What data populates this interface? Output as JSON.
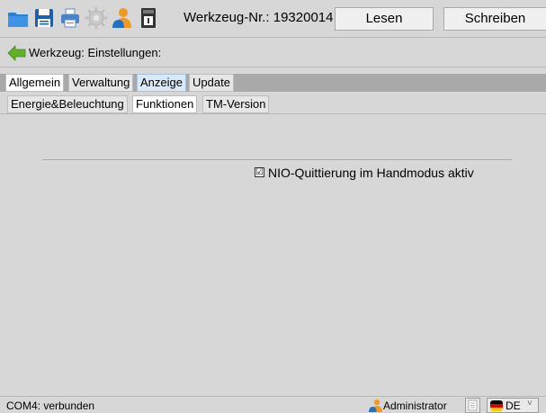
{
  "toolbar": {
    "icons": [
      "folder-icon",
      "save-icon",
      "print-icon",
      "settings-icon",
      "user-icon",
      "device-icon"
    ],
    "tool_number_label": "Werkzeug-Nr.: 19320014",
    "read_label": "Lesen",
    "write_label": "Schreiben"
  },
  "titlebar": {
    "back_icon": "arrow-left-icon",
    "title": "Werkzeug: Einstellungen:"
  },
  "tabs_primary": [
    {
      "label": "Allgemein",
      "state": "active"
    },
    {
      "label": "Verwaltung",
      "state": "normal"
    },
    {
      "label": "Anzeige",
      "state": "hover"
    },
    {
      "label": "Update",
      "state": "normal"
    }
  ],
  "tabs_secondary": [
    {
      "label": "Energie&Beleuchtung",
      "state": "normal"
    },
    {
      "label": "Funktionen",
      "state": "active"
    },
    {
      "label": "TM-Version",
      "state": "normal"
    }
  ],
  "content": {
    "checkbox": {
      "label": "NIO-Quittierung im Handmodus aktiv",
      "checked": true,
      "mark": "☑"
    }
  },
  "statusbar": {
    "connection": "COM4: verbunden",
    "user": "Administrator",
    "language": "DE",
    "dropdown_arrow": "˅"
  },
  "colors": {
    "background": "#d7d7d7",
    "accent_blue": "#1e73c8",
    "folder_blue": "#2d7fd4",
    "hover_tab": "#dbe8f5"
  }
}
